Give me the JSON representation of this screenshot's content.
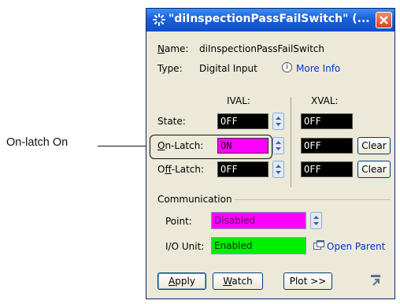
{
  "callout": {
    "label": "On-latch On"
  },
  "window": {
    "title": "\"diInspectionPassFailSwitch\" (...",
    "name_label": "Name:",
    "name_value": "diInspectionPassFailSwitch",
    "type_label": "Type:",
    "type_value": "Digital Input",
    "more_info": "More Info",
    "ival_header": "IVAL:",
    "xval_header": "XVAL:",
    "rows": [
      {
        "label": "State:",
        "ival": "OFF",
        "xval": "OFF"
      },
      {
        "label": "On-Latch:",
        "ival": "ON",
        "xval": "OFF",
        "clear": "Clear"
      },
      {
        "label": "Off-Latch:",
        "ival": "OFF",
        "xval": "OFF",
        "clear": "Clear"
      }
    ],
    "communication": {
      "header": "Communication",
      "point_label": "Point:",
      "point_value": "Disabled",
      "io_label": "I/O Unit:",
      "io_value": "Enabled",
      "open_parent": "Open Parent"
    },
    "buttons": {
      "apply": "Apply",
      "watch": "Watch",
      "plot": "Plot >>"
    },
    "colors": {
      "on": "#ff00ff",
      "disabled": "#ff00ff",
      "enabled": "#00f000",
      "value_bg": "#000000"
    }
  }
}
